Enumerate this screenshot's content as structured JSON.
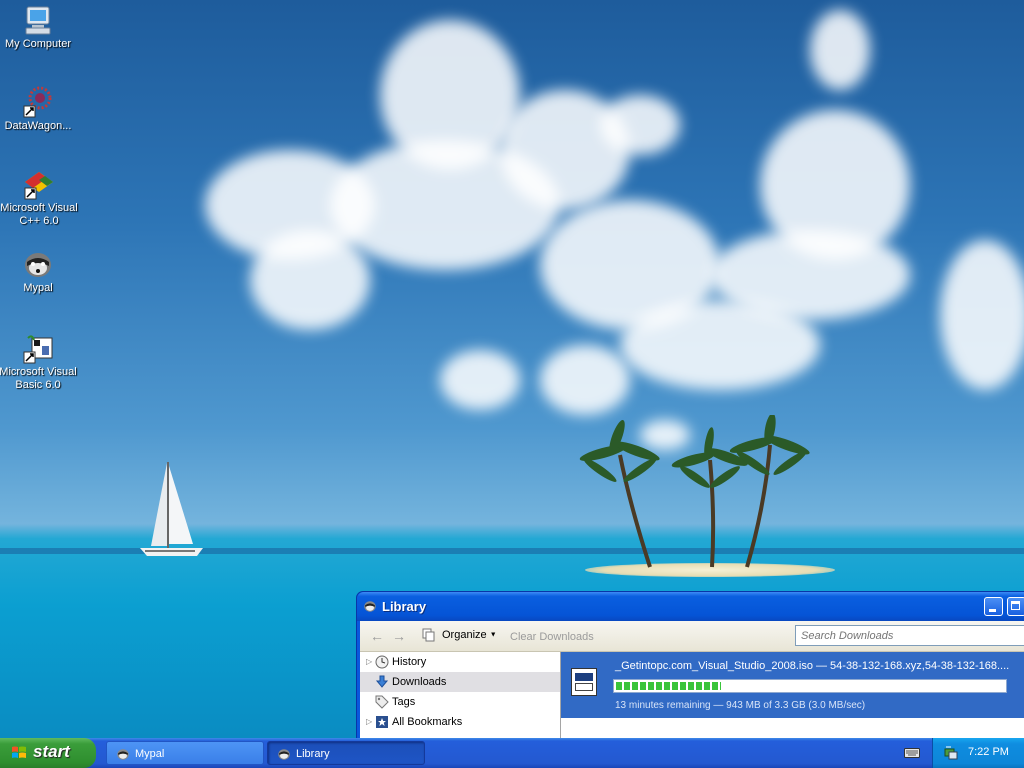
{
  "desktop": {
    "icons": [
      {
        "label": "My Computer",
        "icon": "my-computer-icon"
      },
      {
        "label": "DataWagon...",
        "icon": "datawagon-icon"
      },
      {
        "label": "Microsoft Visual C++ 6.0",
        "icon": "visual-cpp-icon"
      },
      {
        "label": "Mypal",
        "icon": "mypal-icon"
      },
      {
        "label": "Microsoft Visual Basic 6.0",
        "icon": "visual-basic-icon"
      }
    ]
  },
  "library": {
    "title": "Library",
    "toolbar": {
      "organize_label": "Organize",
      "clear_downloads_label": "Clear Downloads",
      "search_placeholder": "Search Downloads"
    },
    "sidebar": {
      "items": [
        {
          "label": "History",
          "icon": "clock-icon",
          "selected": false
        },
        {
          "label": "Downloads",
          "icon": "download-arrow-icon",
          "selected": true
        },
        {
          "label": "Tags",
          "icon": "tag-icon",
          "selected": false
        },
        {
          "label": "All Bookmarks",
          "icon": "bookmark-star-icon",
          "selected": false
        }
      ]
    },
    "download": {
      "name": "_Getintopc.com_Visual_Studio_2008.iso — 54-38-132-168.xyz,54-38-132-168....",
      "status": "13 minutes remaining — 943 MB of 3.3 GB (3.0 MB/sec)",
      "progress": 0.27
    }
  },
  "taskbar": {
    "start_label": "start",
    "tasks": [
      {
        "label": "Mypal",
        "icon": "mypal-icon",
        "active": false
      },
      {
        "label": "Library",
        "icon": "mypal-icon",
        "active": true
      }
    ],
    "clock": "7:22 PM"
  },
  "colors": {
    "titlebar": "#0554d6",
    "selection": "#316ac5",
    "progress": "#3ac43a",
    "taskbar": "#245edb",
    "start_button": "#3a9d3a"
  }
}
